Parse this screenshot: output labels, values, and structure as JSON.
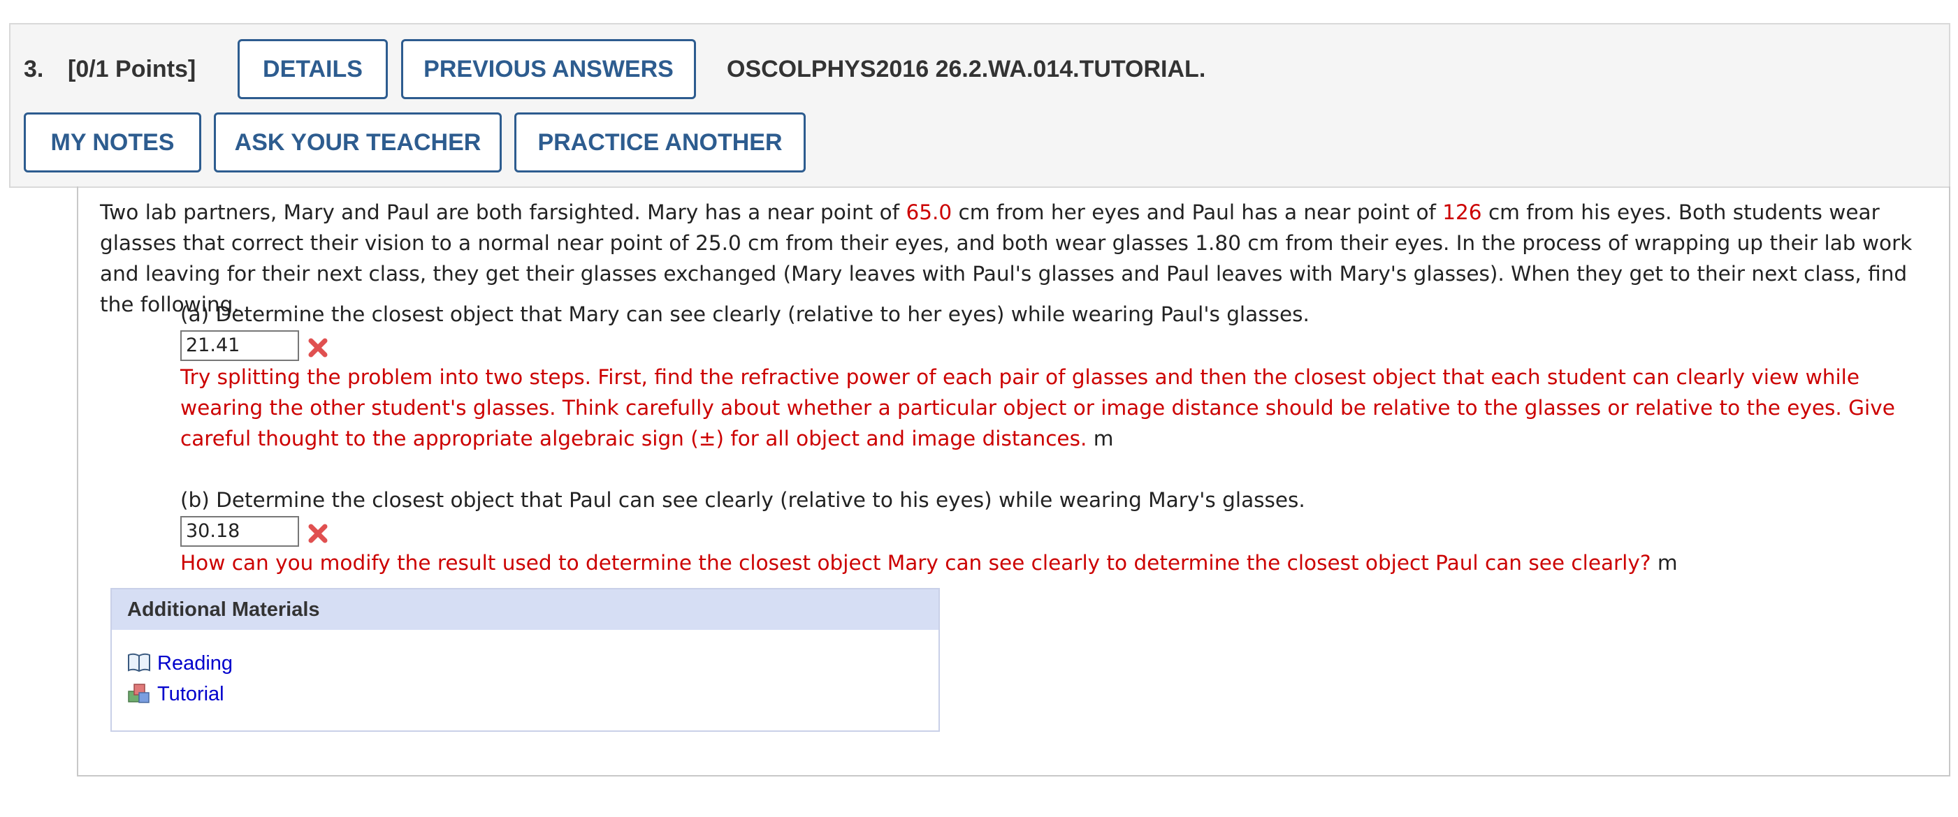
{
  "question": {
    "number": "3.",
    "points": "[0/1 Points]",
    "code": "OSCOLPHYS2016 26.2.WA.014.TUTORIAL."
  },
  "buttons": {
    "details": "DETAILS",
    "previous_answers": "PREVIOUS ANSWERS",
    "my_notes": "MY NOTES",
    "ask_teacher": "ASK YOUR TEACHER",
    "practice_another": "PRACTICE ANOTHER"
  },
  "problem": {
    "text_1": "Two lab partners, Mary and Paul are both farsighted. Mary has a near point of ",
    "mary_near_point": "65.0",
    "text_2": " cm from her eyes and Paul has a near point of ",
    "paul_near_point": "126",
    "text_3": " cm from his eyes. Both students wear glasses that correct their vision to a normal near point of 25.0 cm from their eyes, and both wear glasses 1.80 cm from their eyes. In the process of wrapping up their lab work and leaving for their next class, they get their glasses exchanged (Mary leaves with Paul's glasses and Paul leaves with Mary's glasses). When they get to their next class, find the following."
  },
  "part_a": {
    "question": "(a) Determine the closest object that Mary can see clearly (relative to her eyes) while wearing Paul's glasses.",
    "answer": "21.41",
    "feedback": "Try splitting the problem into two steps. First, find the refractive power of each pair of glasses and then the closest object that each student can clearly view while wearing the other student's glasses. Think carefully about whether a particular object or image distance should be relative to the glasses or relative to the eyes. Give careful thought to the appropriate algebraic sign (±) for all object and image distances.",
    "unit": "m"
  },
  "part_b": {
    "question": "(b) Determine the closest object that Paul can see clearly (relative to his eyes) while wearing Mary's glasses.",
    "answer": "30.18",
    "feedback": "How can you modify the result used to determine the closest object Mary can see clearly to determine the closest object Paul can see clearly?",
    "unit": "m"
  },
  "materials": {
    "title": "Additional Materials",
    "links": [
      "Reading",
      "Tutorial"
    ]
  },
  "colors": {
    "accent": "#2d5c8f",
    "error": "#cc0000",
    "link": "#0000cc",
    "materials_header": "#d6def4"
  }
}
